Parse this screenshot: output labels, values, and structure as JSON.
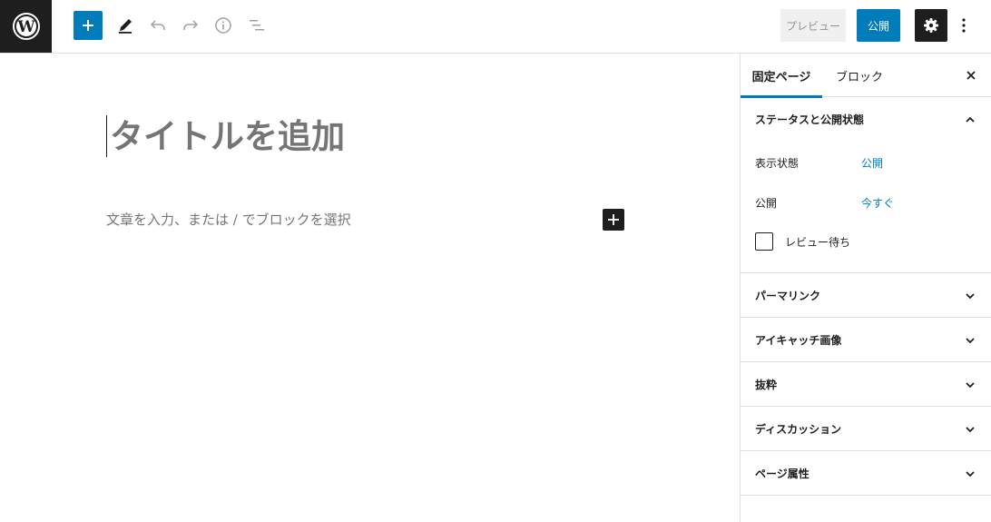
{
  "toolbar": {
    "preview_label": "プレビュー",
    "publish_label": "公開"
  },
  "editor": {
    "title_placeholder": "タイトルを追加",
    "paragraph_placeholder": "文章を入力、または / でブロックを選択"
  },
  "sidebar": {
    "tabs": [
      {
        "label": "固定ページ",
        "active": true
      },
      {
        "label": "ブロック",
        "active": false
      }
    ],
    "status_panel": {
      "title": "ステータスと公開状態",
      "visibility_label": "表示状態",
      "visibility_value": "公開",
      "publish_label": "公開",
      "publish_value": "今すぐ",
      "pending_review_label": "レビュー待ち"
    },
    "panels": [
      {
        "title": "パーマリンク"
      },
      {
        "title": "アイキャッチ画像"
      },
      {
        "title": "抜粋"
      },
      {
        "title": "ディスカッション"
      },
      {
        "title": "ページ属性"
      }
    ]
  },
  "colors": {
    "accent": "#007cba",
    "dark": "#1e1e1e"
  }
}
